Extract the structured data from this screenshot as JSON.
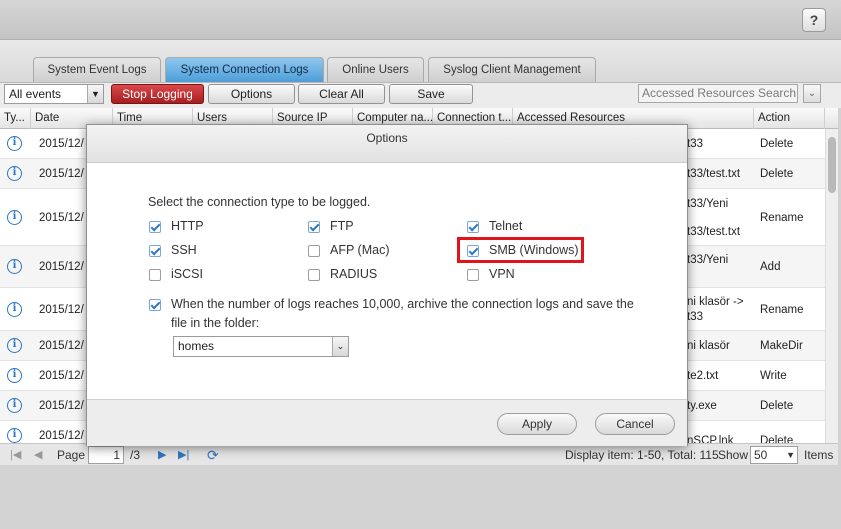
{
  "help_label": "?",
  "tabs": [
    {
      "label": "System Event Logs"
    },
    {
      "label": "System Connection Logs"
    },
    {
      "label": "Online Users"
    },
    {
      "label": "Syslog Client Management"
    }
  ],
  "toolbar": {
    "filter_value": "All events",
    "stop_logging": "Stop Logging",
    "options": "Options",
    "clear_all": "Clear All",
    "save": "Save",
    "search_placeholder": "Accessed Resources Search"
  },
  "grid": {
    "columns": [
      "Ty...",
      "Date",
      "Time",
      "Users",
      "Source IP",
      "Computer na...",
      "Connection t...",
      "Accessed Resources",
      "Action"
    ],
    "rows": [
      {
        "date": "2015/12/",
        "res1": "t33",
        "res2": "",
        "action": "Delete"
      },
      {
        "date": "2015/12/",
        "res1": "t33/test.txt",
        "res2": "",
        "action": "Delete"
      },
      {
        "date": "2015/12/",
        "res1": "t33/Yeni",
        "res2": "t33/test.txt",
        "action": "Rename"
      },
      {
        "date": "2015/12/",
        "res1": "t33/Yeni",
        "res2": "",
        "action": "Add"
      },
      {
        "date": "2015/12/",
        "res1": "ni klasör ->",
        "res2": "t33",
        "action": "Rename"
      },
      {
        "date": "2015/12/",
        "res1": "ni klasör",
        "res2": "",
        "action": "MakeDir"
      },
      {
        "date": "2015/12/",
        "res1": "te2.txt",
        "res2": "",
        "action": "Write"
      },
      {
        "date": "2015/12/",
        "res1": "ty.exe",
        "res2": "",
        "action": "Delete"
      },
      {
        "date": "2015/12/",
        "res1": "nSCP.lnk",
        "res2": "",
        "action": "Delete"
      }
    ]
  },
  "pager": {
    "page_label": "Page",
    "page_value": "1",
    "total_pages": "/3",
    "display_info": "Display item: 1-50, Total: 115",
    "show_label": "Show",
    "show_value": "50",
    "items_label": "Items"
  },
  "modal": {
    "title": "Options",
    "instruction": "Select the connection type to be logged.",
    "options": [
      {
        "label": "HTTP",
        "checked": true
      },
      {
        "label": "FTP",
        "checked": true
      },
      {
        "label": "Telnet",
        "checked": true
      },
      {
        "label": "SSH",
        "checked": true
      },
      {
        "label": "AFP (Mac)",
        "checked": false
      },
      {
        "label": "SMB (Windows)",
        "checked": true
      },
      {
        "label": "iSCSI",
        "checked": false
      },
      {
        "label": "RADIUS",
        "checked": false
      },
      {
        "label": "VPN",
        "checked": false
      }
    ],
    "archive_line1": "When the number of logs reaches 10,000, archive the connection logs and save the",
    "archive_line2": "file in the folder:",
    "archive_checked": true,
    "folder_value": "homes",
    "apply": "Apply",
    "cancel": "Cancel"
  },
  "colors": {
    "active_tab": "#4d9ed8",
    "stop_button": "#b52a2c",
    "highlight": "#e0141b",
    "checkbox": "#2f78c4"
  },
  "icons": [
    "help-icon",
    "info-icon",
    "dropdown-arrow-icon",
    "first-page-icon",
    "prev-page-icon",
    "next-page-icon",
    "last-page-icon",
    "refresh-icon",
    "checkmark-icon"
  ]
}
